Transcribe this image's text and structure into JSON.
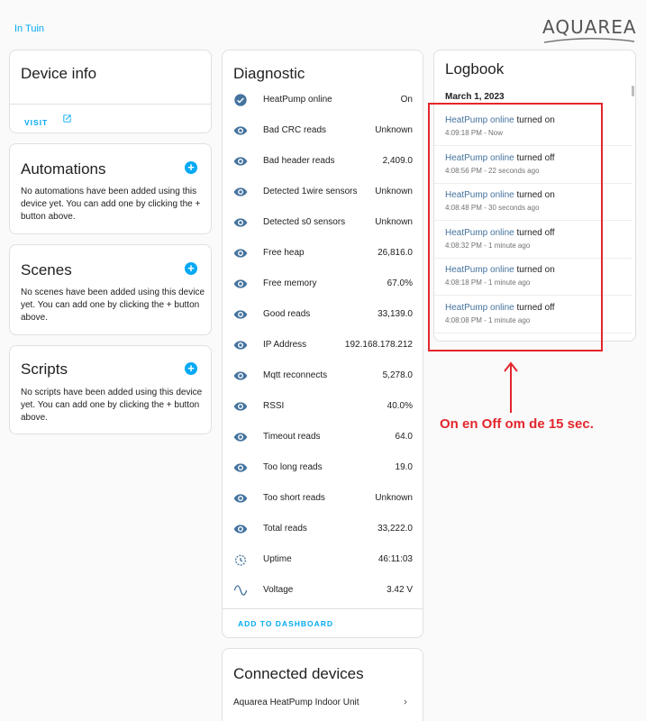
{
  "header": {
    "area_link": "In Tuin",
    "logo_text": "AQUAREA"
  },
  "device_info": {
    "title": "Device info",
    "visit_label": "VISIT"
  },
  "automations": {
    "title": "Automations",
    "text": "No automations have been added using this device yet. You can add one by clicking the + button above."
  },
  "scenes": {
    "title": "Scenes",
    "text": "No scenes have been added using this device yet. You can add one by clicking the + button above."
  },
  "scripts": {
    "title": "Scripts",
    "text": "No scripts have been added using this device yet. You can add one by clicking the + button above."
  },
  "diagnostic": {
    "title": "Diagnostic",
    "rows": [
      {
        "label": "HeatPump online",
        "value": "On",
        "icon": "check-circle-icon"
      },
      {
        "label": "Bad CRC reads",
        "value": "Unknown",
        "icon": "eye-icon"
      },
      {
        "label": "Bad header reads",
        "value": "2,409.0",
        "icon": "eye-icon"
      },
      {
        "label": "Detected 1wire sensors",
        "value": "Unknown",
        "icon": "eye-icon"
      },
      {
        "label": "Detected s0 sensors",
        "value": "Unknown",
        "icon": "eye-icon"
      },
      {
        "label": "Free heap",
        "value": "26,816.0",
        "icon": "eye-icon"
      },
      {
        "label": "Free memory",
        "value": "67.0%",
        "icon": "eye-icon"
      },
      {
        "label": "Good reads",
        "value": "33,139.0",
        "icon": "eye-icon"
      },
      {
        "label": "IP Address",
        "value": "192.168.178.212",
        "icon": "eye-icon"
      },
      {
        "label": "Mqtt reconnects",
        "value": "5,278.0",
        "icon": "eye-icon"
      },
      {
        "label": "RSSI",
        "value": "40.0%",
        "icon": "eye-icon"
      },
      {
        "label": "Timeout reads",
        "value": "64.0",
        "icon": "eye-icon"
      },
      {
        "label": "Too long reads",
        "value": "19.0",
        "icon": "eye-icon"
      },
      {
        "label": "Too short reads",
        "value": "Unknown",
        "icon": "eye-icon"
      },
      {
        "label": "Total reads",
        "value": "33,222.0",
        "icon": "eye-icon"
      },
      {
        "label": "Uptime",
        "value": "46:11:03",
        "icon": "timer-icon"
      },
      {
        "label": "Voltage",
        "value": "3.42 V",
        "icon": "sine-wave-icon"
      }
    ],
    "add_to_dashboard": "ADD TO DASHBOARD"
  },
  "connected_devices": {
    "title": "Connected devices",
    "item": "Aquarea HeatPump Indoor Unit"
  },
  "logbook": {
    "title": "Logbook",
    "date": "March 1, 2023",
    "entries": [
      {
        "entity": "HeatPump online",
        "action": "turned on",
        "meta": "4:09:18 PM - Now"
      },
      {
        "entity": "HeatPump online",
        "action": "turned off",
        "meta": "4:08:56 PM - 22 seconds ago"
      },
      {
        "entity": "HeatPump online",
        "action": "turned on",
        "meta": "4:08:48 PM - 30 seconds ago"
      },
      {
        "entity": "HeatPump online",
        "action": "turned off",
        "meta": "4:08:32 PM - 1 minute ago"
      },
      {
        "entity": "HeatPump online",
        "action": "turned on",
        "meta": "4:08:18 PM - 1 minute ago"
      },
      {
        "entity": "HeatPump online",
        "action": "turned off",
        "meta": "4:08:08 PM - 1 minute ago"
      }
    ]
  },
  "annotation": {
    "text": "On en Off om de 15 sec.",
    "color": "#e3262c"
  },
  "colors": {
    "accent": "#03a9f4",
    "entity_link": "#44739e",
    "icon": "#44739e"
  }
}
